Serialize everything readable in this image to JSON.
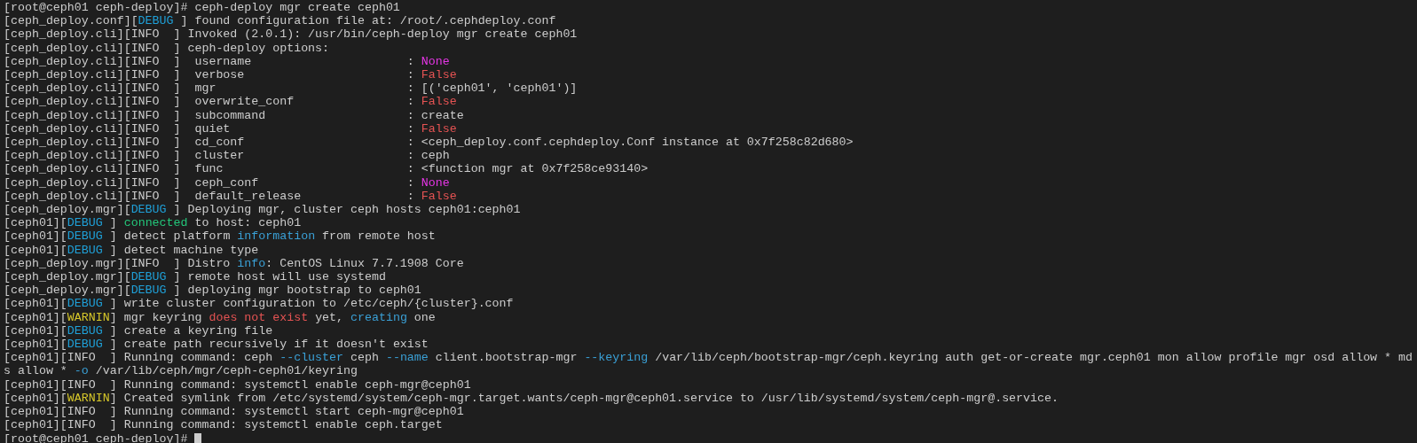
{
  "terminal": {
    "lines": [
      {
        "segments": [
          {
            "text": "[root@ceph01 ceph-deploy]# ceph-deploy mgr create ceph01",
            "color": "#cccccc"
          }
        ]
      },
      {
        "segments": [
          {
            "text": "[ceph_deploy.conf][",
            "color": "#cccccc"
          },
          {
            "text": "DEBUG",
            "color": "#1fa0d8"
          },
          {
            "text": " ] found configuration file at: /root/.cephdeploy.conf",
            "color": "#cccccc"
          }
        ]
      },
      {
        "segments": [
          {
            "text": "[ceph_deploy.cli][INFO  ] Invoked (2.0.1): /usr/bin/ceph-deploy mgr create ceph01",
            "color": "#cccccc"
          }
        ]
      },
      {
        "segments": [
          {
            "text": "[ceph_deploy.cli][INFO  ] ceph-deploy options:",
            "color": "#cccccc"
          }
        ]
      },
      {
        "segments": [
          {
            "text": "[ceph_deploy.cli][INFO  ]  username                      : ",
            "color": "#cccccc"
          },
          {
            "text": "None",
            "color": "#e535e5"
          }
        ]
      },
      {
        "segments": [
          {
            "text": "[ceph_deploy.cli][INFO  ]  verbose                       : ",
            "color": "#cccccc"
          },
          {
            "text": "False",
            "color": "#e55353"
          }
        ]
      },
      {
        "segments": [
          {
            "text": "[ceph_deploy.cli][INFO  ]  mgr                           : [('ceph01', 'ceph01')]",
            "color": "#cccccc"
          }
        ]
      },
      {
        "segments": [
          {
            "text": "[ceph_deploy.cli][INFO  ]  overwrite_conf                : ",
            "color": "#cccccc"
          },
          {
            "text": "False",
            "color": "#e55353"
          }
        ]
      },
      {
        "segments": [
          {
            "text": "[ceph_deploy.cli][INFO  ]  subcommand                    : create",
            "color": "#cccccc"
          }
        ]
      },
      {
        "segments": [
          {
            "text": "[ceph_deploy.cli][INFO  ]  quiet                         : ",
            "color": "#cccccc"
          },
          {
            "text": "False",
            "color": "#e55353"
          }
        ]
      },
      {
        "segments": [
          {
            "text": "[ceph_deploy.cli][INFO  ]  cd_conf                       : <ceph_deploy.conf.cephdeploy.Conf instance at 0x7f258c82d680>",
            "color": "#cccccc"
          }
        ]
      },
      {
        "segments": [
          {
            "text": "[ceph_deploy.cli][INFO  ]  cluster                       : ceph",
            "color": "#cccccc"
          }
        ]
      },
      {
        "segments": [
          {
            "text": "[ceph_deploy.cli][INFO  ]  func                          : <function mgr at 0x7f258ce93140>",
            "color": "#cccccc"
          }
        ]
      },
      {
        "segments": [
          {
            "text": "[ceph_deploy.cli][INFO  ]  ceph_conf                     : ",
            "color": "#cccccc"
          },
          {
            "text": "None",
            "color": "#e535e5"
          }
        ]
      },
      {
        "segments": [
          {
            "text": "[ceph_deploy.cli][INFO  ]  default_release               : ",
            "color": "#cccccc"
          },
          {
            "text": "False",
            "color": "#e55353"
          }
        ]
      },
      {
        "segments": [
          {
            "text": "[ceph_deploy.mgr][",
            "color": "#cccccc"
          },
          {
            "text": "DEBUG",
            "color": "#1fa0d8"
          },
          {
            "text": " ] Deploying mgr, cluster ceph hosts ceph01:ceph01",
            "color": "#cccccc"
          }
        ]
      },
      {
        "segments": [
          {
            "text": "[ceph01][",
            "color": "#cccccc"
          },
          {
            "text": "DEBUG",
            "color": "#1fa0d8"
          },
          {
            "text": " ] ",
            "color": "#cccccc"
          },
          {
            "text": "connected",
            "color": "#23c77a"
          },
          {
            "text": " to host: ceph01",
            "color": "#cccccc"
          }
        ]
      },
      {
        "segments": [
          {
            "text": "[ceph01][",
            "color": "#cccccc"
          },
          {
            "text": "DEBUG",
            "color": "#1fa0d8"
          },
          {
            "text": " ] detect platform ",
            "color": "#cccccc"
          },
          {
            "text": "information",
            "color": "#3aa0d6"
          },
          {
            "text": " from remote host",
            "color": "#cccccc"
          }
        ]
      },
      {
        "segments": [
          {
            "text": "[ceph01][",
            "color": "#cccccc"
          },
          {
            "text": "DEBUG",
            "color": "#1fa0d8"
          },
          {
            "text": " ] detect machine type",
            "color": "#cccccc"
          }
        ]
      },
      {
        "segments": [
          {
            "text": "[ceph_deploy.mgr][INFO  ] Distro ",
            "color": "#cccccc"
          },
          {
            "text": "info",
            "color": "#3aa0d6"
          },
          {
            "text": ": CentOS Linux 7.7.1908 Core",
            "color": "#cccccc"
          }
        ]
      },
      {
        "segments": [
          {
            "text": "[ceph_deploy.mgr][",
            "color": "#cccccc"
          },
          {
            "text": "DEBUG",
            "color": "#1fa0d8"
          },
          {
            "text": " ] remote host will use systemd",
            "color": "#cccccc"
          }
        ]
      },
      {
        "segments": [
          {
            "text": "[ceph_deploy.mgr][",
            "color": "#cccccc"
          },
          {
            "text": "DEBUG",
            "color": "#1fa0d8"
          },
          {
            "text": " ] deploying mgr bootstrap to ceph01",
            "color": "#cccccc"
          }
        ]
      },
      {
        "segments": [
          {
            "text": "[ceph01][",
            "color": "#cccccc"
          },
          {
            "text": "DEBUG",
            "color": "#1fa0d8"
          },
          {
            "text": " ] write cluster configuration to /etc/ceph/{cluster}.conf",
            "color": "#cccccc"
          }
        ]
      },
      {
        "segments": [
          {
            "text": "[ceph01][",
            "color": "#cccccc"
          },
          {
            "text": "WARNIN",
            "color": "#d6c72a"
          },
          {
            "text": "] mgr keyring ",
            "color": "#cccccc"
          },
          {
            "text": "does not exist",
            "color": "#e55353"
          },
          {
            "text": " yet, ",
            "color": "#cccccc"
          },
          {
            "text": "creating",
            "color": "#3aa0d6"
          },
          {
            "text": " one",
            "color": "#cccccc"
          }
        ]
      },
      {
        "segments": [
          {
            "text": "[ceph01][",
            "color": "#cccccc"
          },
          {
            "text": "DEBUG",
            "color": "#1fa0d8"
          },
          {
            "text": " ] create a keyring file",
            "color": "#cccccc"
          }
        ]
      },
      {
        "segments": [
          {
            "text": "[ceph01][",
            "color": "#cccccc"
          },
          {
            "text": "DEBUG",
            "color": "#1fa0d8"
          },
          {
            "text": " ] create path recursively if it doesn't exist",
            "color": "#cccccc"
          }
        ]
      },
      {
        "segments": [
          {
            "text": "[ceph01][INFO  ] Running command: ceph ",
            "color": "#cccccc"
          },
          {
            "text": "--cluster",
            "color": "#3aa0d6"
          },
          {
            "text": " ceph ",
            "color": "#cccccc"
          },
          {
            "text": "--name",
            "color": "#3aa0d6"
          },
          {
            "text": " client.bootstrap-mgr ",
            "color": "#cccccc"
          },
          {
            "text": "--keyring",
            "color": "#3aa0d6"
          },
          {
            "text": " /var/lib/ceph/bootstrap-mgr/ceph.keyring auth get-or-create mgr.ceph01 mon allow profile mgr osd allow * md",
            "color": "#cccccc"
          }
        ]
      },
      {
        "segments": [
          {
            "text": "s allow * ",
            "color": "#cccccc"
          },
          {
            "text": "-o",
            "color": "#3aa0d6"
          },
          {
            "text": " /var/lib/ceph/mgr/ceph-ceph01/keyring",
            "color": "#cccccc"
          }
        ]
      },
      {
        "segments": [
          {
            "text": "[ceph01][INFO  ] Running command: systemctl enable ceph-mgr@ceph01",
            "color": "#cccccc"
          }
        ]
      },
      {
        "segments": [
          {
            "text": "[ceph01][",
            "color": "#cccccc"
          },
          {
            "text": "WARNIN",
            "color": "#d6c72a"
          },
          {
            "text": "] Created symlink from /etc/systemd/system/ceph-mgr.target.wants/ceph-mgr@ceph01.service to /usr/lib/systemd/system/ceph-mgr@.service.",
            "color": "#cccccc"
          }
        ]
      },
      {
        "segments": [
          {
            "text": "[ceph01][INFO  ] Running command: systemctl start ceph-mgr@ceph01",
            "color": "#cccccc"
          }
        ]
      },
      {
        "segments": [
          {
            "text": "[ceph01][INFO  ] Running command: systemctl enable ceph.target",
            "color": "#cccccc"
          }
        ]
      }
    ],
    "prompt": "[root@ceph01 ceph-deploy]# "
  }
}
